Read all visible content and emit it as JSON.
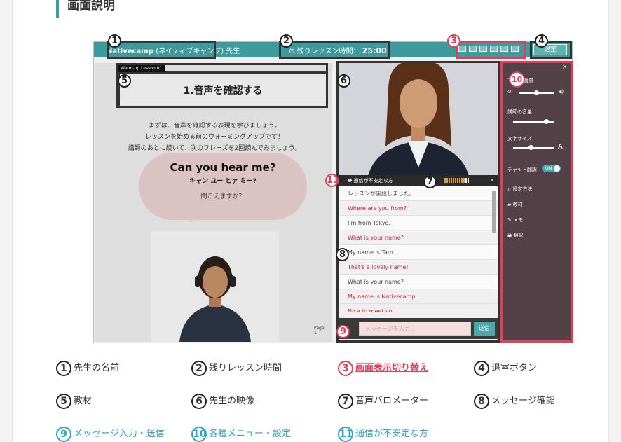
{
  "section": {
    "title": "画面説明"
  },
  "lesson": {
    "teacher_name": "Nativecamp",
    "teacher_name_sub": "(ネイティブキャンプ) 先生",
    "timer_label": "残りレッスン時間：",
    "timer_value": "25:00",
    "exit_button": "退室"
  },
  "material": {
    "tag": "Warm-up Lesson 01",
    "title": "1.音声を確認する",
    "intro_lines": [
      "まずは、音声を確認する表現を学びましょう。",
      "レッスンを始める前のウォーミングアップです！",
      "講師のあとに続いて、次のフレーズを2回読んでみましょう。"
    ],
    "phrase_en": "Can you hear me?",
    "phrase_kana": "キャン ユー ヒァ ミー?",
    "phrase_ja": "聞こえますか？",
    "page_number": "Page 1"
  },
  "chat": {
    "warning": "通信が不安定な方",
    "close": "×",
    "messages": [
      {
        "text": "レッスンが開始しました。",
        "speaker": "system"
      },
      {
        "text": "Where are you from?",
        "speaker": "teacher"
      },
      {
        "text": "I'm from Tokyo.",
        "speaker": "student"
      },
      {
        "text": "What is your name?",
        "speaker": "teacher"
      },
      {
        "text": "My name is Taro.",
        "speaker": "student"
      },
      {
        "text": "That's a lovely name!",
        "speaker": "teacher"
      },
      {
        "text": "What is your name?",
        "speaker": "student"
      },
      {
        "text": "My name is Nativecamp.",
        "speaker": "teacher"
      },
      {
        "text": "Nice to meet you.",
        "speaker": "teacher"
      }
    ],
    "input_placeholder": "メッセージを入力...",
    "send_button": "送信",
    "barometer_level": 0.83
  },
  "menu": {
    "close": "×",
    "volume_label": "マイク/音量",
    "teacher_volume_label": "講師の音量",
    "font_size_label": "文字サイズ",
    "chat_translate_label": "チャット翻訳",
    "chat_translate_state": "ON",
    "items": [
      "設定方法",
      "教材",
      "メモ",
      "翻訳"
    ]
  },
  "badges": [
    "1",
    "2",
    "3",
    "4",
    "5",
    "6",
    "7",
    "8",
    "9",
    "10",
    "11"
  ],
  "legend": [
    {
      "num": "1",
      "label": "先生の名前",
      "style": "normal"
    },
    {
      "num": "2",
      "label": "残りレッスン時間",
      "style": "normal"
    },
    {
      "num": "3",
      "label": "画面表示切り替え",
      "style": "red"
    },
    {
      "num": "4",
      "label": "退室ボタン",
      "style": "normal"
    },
    {
      "num": "5",
      "label": "教材",
      "style": "normal"
    },
    {
      "num": "6",
      "label": "先生の映像",
      "style": "normal"
    },
    {
      "num": "7",
      "label": "音声バロメーター",
      "style": "normal"
    },
    {
      "num": "8",
      "label": "メッセージ確認",
      "style": "normal"
    },
    {
      "num": "9",
      "label": "メッセージ入力・送信",
      "style": "blue"
    },
    {
      "num": "10",
      "label": "各種メニュー・設定",
      "style": "blue"
    },
    {
      "num": "11",
      "label": "通信が不安定な方",
      "style": "blue"
    }
  ],
  "colors": {
    "teal": "#3d9b9e",
    "accent_red": "#e0405a",
    "accent_blue": "#31a4c5",
    "menu_bg": "#544047"
  }
}
